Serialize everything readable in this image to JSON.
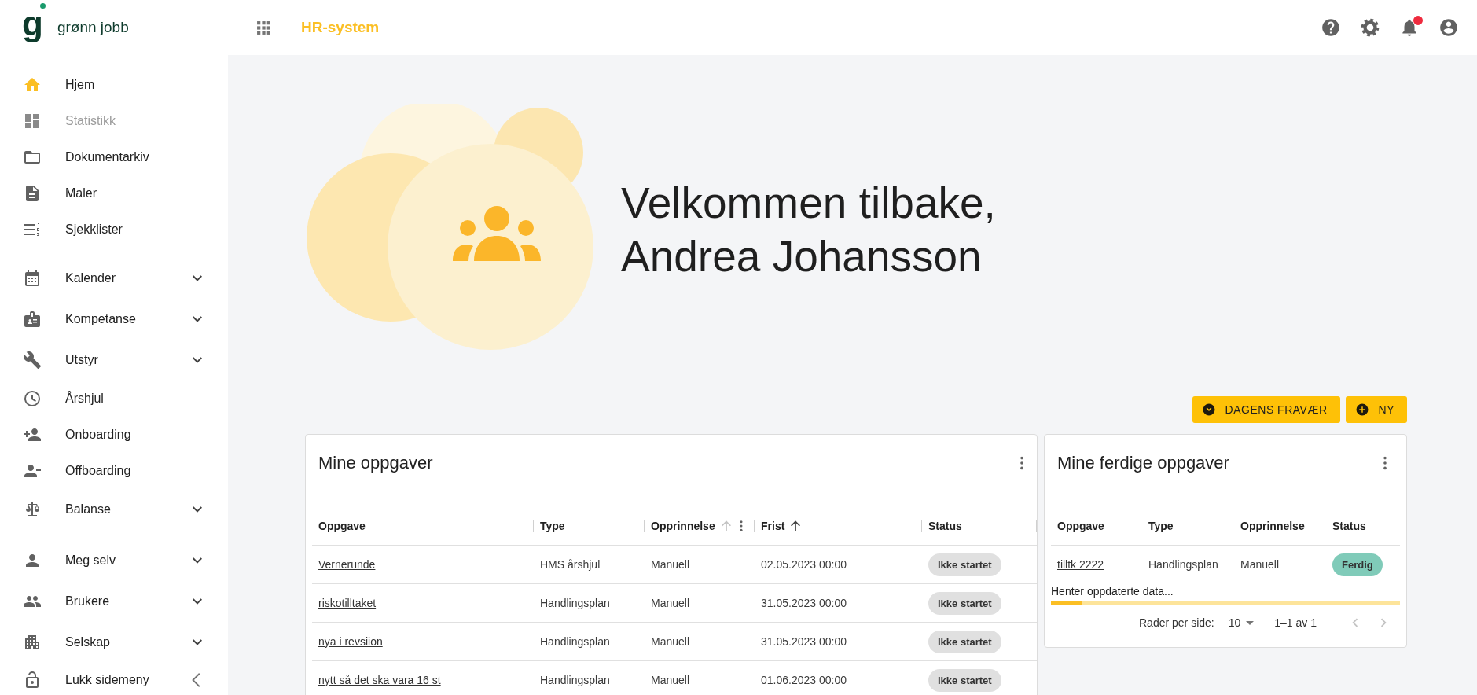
{
  "logo": {
    "mark": "g",
    "name": "grønn jobb"
  },
  "top_bar": {
    "app_title": "HR-system",
    "has_unread_notifications": true
  },
  "sidebar": {
    "sections": [
      {
        "items": [
          {
            "label": "Hjem",
            "kind": "link",
            "selected": true,
            "disabled": false
          },
          {
            "label": "Statistikk",
            "kind": "link",
            "selected": false,
            "disabled": true
          },
          {
            "label": "Dokumentarkiv",
            "kind": "link",
            "selected": false,
            "disabled": false
          },
          {
            "label": "Maler",
            "kind": "link",
            "selected": false,
            "disabled": false
          },
          {
            "label": "Sjekklister",
            "kind": "link",
            "selected": false,
            "disabled": false
          }
        ]
      },
      {
        "items": [
          {
            "label": "Kalender",
            "kind": "group",
            "expanded": false,
            "selected": false,
            "disabled": false
          },
          {
            "label": "Kompetanse",
            "kind": "group",
            "expanded": false,
            "selected": false,
            "disabled": false
          },
          {
            "label": "Utstyr",
            "kind": "group",
            "expanded": false,
            "selected": false,
            "disabled": false
          },
          {
            "label": "Årshjul",
            "kind": "link",
            "selected": false,
            "disabled": false
          },
          {
            "label": "Onboarding",
            "kind": "link",
            "selected": false,
            "disabled": false
          },
          {
            "label": "Offboarding",
            "kind": "link",
            "selected": false,
            "disabled": false
          },
          {
            "label": "Balanse",
            "kind": "group",
            "expanded": false,
            "selected": false,
            "disabled": false
          }
        ]
      },
      {
        "items": [
          {
            "label": "Meg selv",
            "kind": "group",
            "expanded": false,
            "selected": false,
            "disabled": false
          },
          {
            "label": "Brukere",
            "kind": "group",
            "expanded": false,
            "selected": false,
            "disabled": false
          },
          {
            "label": "Selskap",
            "kind": "group",
            "expanded": false,
            "selected": false,
            "disabled": false
          }
        ]
      }
    ],
    "footer": {
      "label": "Lukk sidemeny"
    }
  },
  "hero": {
    "greeting": "Velkommen tilbake,",
    "name": "Andrea Johansson"
  },
  "actions": [
    {
      "label": "DAGENS FRAVÆR",
      "kind": "dropdown"
    },
    {
      "label": "NY",
      "kind": "add"
    }
  ],
  "my_tasks": {
    "title": "Mine oppgaver",
    "columns": [
      {
        "label": "Oppgave"
      },
      {
        "label": "Type"
      },
      {
        "label": "Opprinnelse",
        "sort_icon": true,
        "sorted": false,
        "menu": true
      },
      {
        "label": "Frist",
        "sort_icon": true,
        "sorted": true
      },
      {
        "label": "Status"
      }
    ],
    "rows": [
      {
        "task": "Vernerunde",
        "type": "HMS årshjul",
        "origin": "Manuell",
        "deadline": "02.05.2023 00:00",
        "status": {
          "label": "Ikke startet",
          "color": "#e0e0e0"
        }
      },
      {
        "task": "riskotilltaket",
        "type": "Handlingsplan",
        "origin": "Manuell",
        "deadline": "31.05.2023 00:00",
        "status": {
          "label": "Ikke startet",
          "color": "#e0e0e0"
        }
      },
      {
        "task": "nya i revsiion",
        "type": "Handlingsplan",
        "origin": "Manuell",
        "deadline": "31.05.2023 00:00",
        "status": {
          "label": "Ikke startet",
          "color": "#e0e0e0"
        }
      },
      {
        "task": "nytt så det ska vara 16 st",
        "type": "Handlingsplan",
        "origin": "Manuell",
        "deadline": "01.06.2023 00:00",
        "status": {
          "label": "Ikke startet",
          "color": "#e0e0e0"
        }
      }
    ]
  },
  "my_done_tasks": {
    "title": "Mine ferdige oppgaver",
    "columns": [
      "Oppgave",
      "Type",
      "Opprinnelse",
      "Status"
    ],
    "rows": [
      {
        "task": "tilltk 2222",
        "type": "Handlingsplan",
        "origin": "Manuell",
        "status": {
          "label": "Ferdig",
          "color": "#80cbb9"
        }
      }
    ],
    "loading_text": "Henter oppdaterte data...",
    "loading": {
      "level": 0.09
    },
    "pagination": {
      "rows_label": "Rader per side:",
      "rows_value": "10",
      "range": "1–1 av 1",
      "prev_disabled": true,
      "next_disabled": true
    }
  }
}
